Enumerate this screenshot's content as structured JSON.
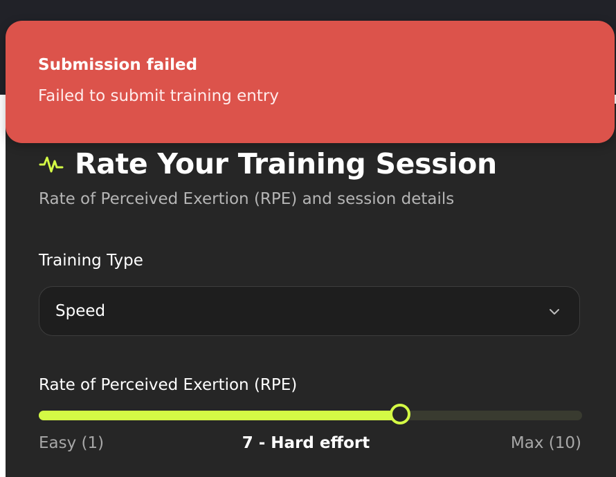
{
  "toast": {
    "title": "Submission failed",
    "message": "Failed to submit training entry"
  },
  "session": {
    "icon": "activity-pulse-icon",
    "title": "Rate Your Training Session",
    "subtitle": "Rate of Perceived Exertion (RPE) and session details"
  },
  "training_type": {
    "label": "Training Type",
    "selected": "Speed"
  },
  "rpe": {
    "label": "Rate of Perceived Exertion (RPE)",
    "min_label": "Easy (1)",
    "max_label": "Max (10)",
    "current_label": "7 - Hard effort",
    "min": 1,
    "max": 10,
    "value": 7
  },
  "colors": {
    "accent": "#d4fa45",
    "toast_background": "#dc534b",
    "card_background": "#262626",
    "header_background": "#212228"
  }
}
